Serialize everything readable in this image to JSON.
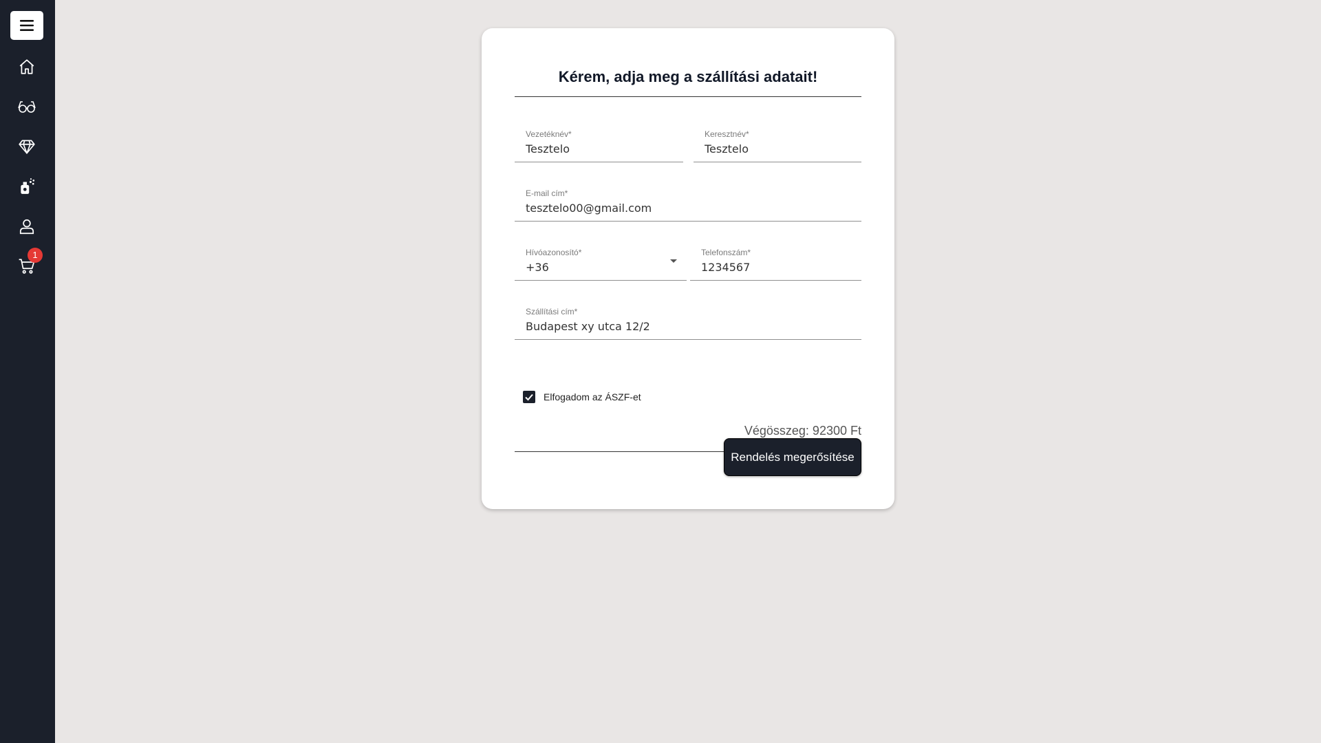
{
  "sidebar": {
    "items": [
      {
        "icon": "home-icon"
      },
      {
        "icon": "glasses-icon"
      },
      {
        "icon": "diamond-icon"
      },
      {
        "icon": "perfume-icon"
      },
      {
        "icon": "user-icon"
      },
      {
        "icon": "cart-icon",
        "badge": "1"
      }
    ]
  },
  "form": {
    "title": "Kérem, adja meg a szállítási adatait!",
    "last_name": {
      "label": "Vezetéknév*",
      "value": "Tesztelo"
    },
    "first_name": {
      "label": "Keresztnév*",
      "value": "Tesztelo"
    },
    "email": {
      "label": "E-mail cím*",
      "value": "tesztelo00@gmail.com"
    },
    "dial_code": {
      "label": "Hívóazonosító*",
      "value": "+36"
    },
    "phone": {
      "label": "Telefonszám*",
      "value": "1234567"
    },
    "address": {
      "label": "Szállítási cím*",
      "value": "Budapest xy utca 12/2"
    },
    "terms_label": "Elfogadom az ÁSZF-et",
    "total": "Végösszeg: 92300 Ft",
    "confirm_label": "Rendelés megerősítése"
  },
  "colors": {
    "sidebar_bg": "#1b202b",
    "page_bg": "#e9e6e5",
    "badge": "#e53935"
  }
}
